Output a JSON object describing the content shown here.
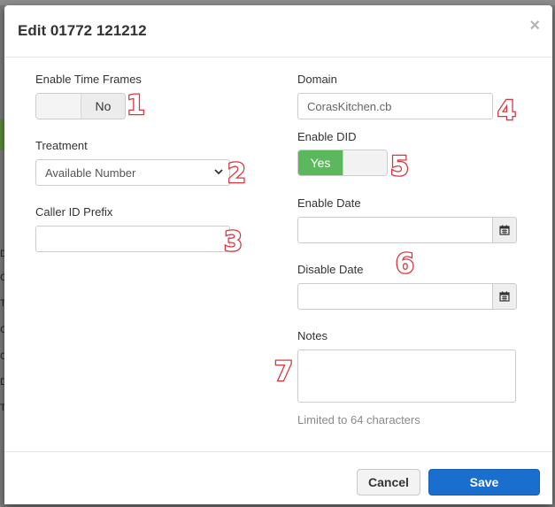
{
  "background": {
    "letters": [
      "D",
      "C",
      "T",
      "C",
      "C",
      "D",
      "T"
    ]
  },
  "modal": {
    "title": "Edit 01772 121212",
    "close_glyph": "×"
  },
  "form": {
    "enable_time_frames": {
      "label": "Enable Time Frames",
      "state": "No"
    },
    "treatment": {
      "label": "Treatment",
      "selected": "Available Number"
    },
    "caller_id_prefix": {
      "label": "Caller ID Prefix",
      "value": ""
    },
    "domain": {
      "label": "Domain",
      "value": "CorasKitchen.cb"
    },
    "enable_did": {
      "label": "Enable DID",
      "state": "Yes"
    },
    "enable_date": {
      "label": "Enable Date",
      "value": "",
      "icon": "calendar-icon"
    },
    "disable_date": {
      "label": "Disable Date",
      "value": "",
      "icon": "calendar-icon"
    },
    "notes": {
      "label": "Notes",
      "value": "",
      "help": "Limited to 64 characters"
    }
  },
  "annotations": [
    "1",
    "2",
    "3",
    "4",
    "5",
    "6",
    "7"
  ],
  "footer": {
    "cancel_label": "Cancel",
    "save_label": "Save"
  },
  "colors": {
    "primary": "#1a6fce",
    "toggle_on": "#5cb85c",
    "annotation_stroke": "#d9363e"
  }
}
